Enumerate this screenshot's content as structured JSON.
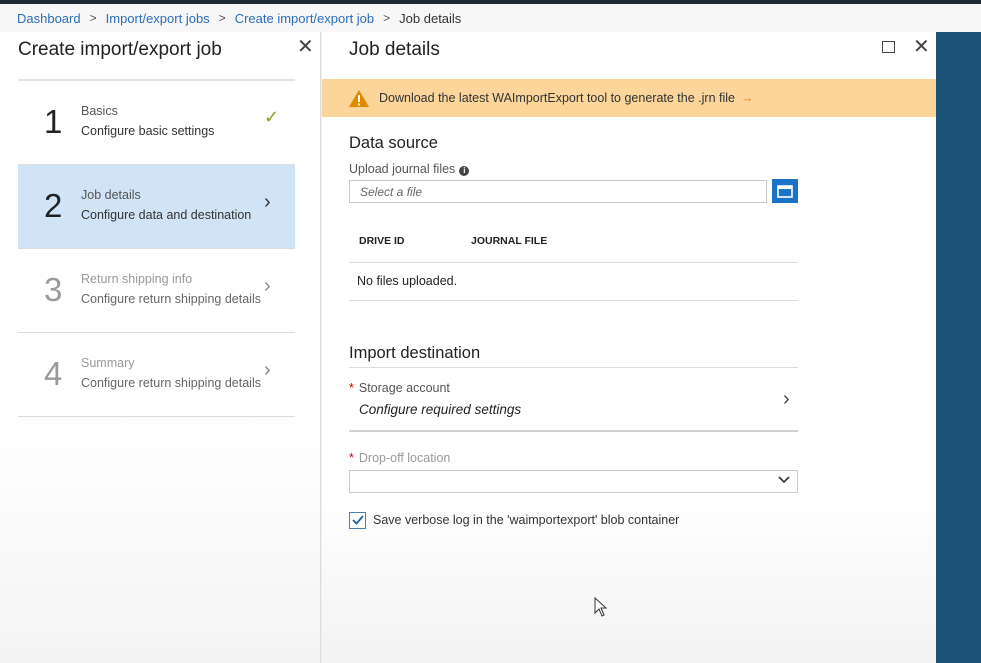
{
  "breadcrumb": {
    "items": [
      "Dashboard",
      "Import/export jobs",
      "Create import/export job"
    ],
    "current": "Job details",
    "separator": ">"
  },
  "left_blade": {
    "title": "Create import/export job",
    "close_glyph": "✕",
    "steps": [
      {
        "number": "1",
        "title": "Basics",
        "subtitle": "Configure basic settings",
        "state": "completed",
        "indicator": "✓"
      },
      {
        "number": "2",
        "title": "Job details",
        "subtitle": "Configure data and destination",
        "state": "active",
        "indicator": "›"
      },
      {
        "number": "3",
        "title": "Return shipping info",
        "subtitle": "Configure return shipping details",
        "state": "pending",
        "indicator": "›"
      },
      {
        "number": "4",
        "title": "Summary",
        "subtitle": "Configure return shipping details",
        "state": "pending",
        "indicator": "›"
      }
    ]
  },
  "right_blade": {
    "title": "Job details",
    "close_glyph": "✕",
    "warning": {
      "text": "Download the latest WAImportExport tool to generate the .jrn file",
      "arrow": "→"
    },
    "data_source": {
      "title": "Data source",
      "upload_label": "Upload journal files",
      "upload_info": "i",
      "upload_placeholder": "Select a file",
      "table_headers": [
        "DRIVE ID",
        "JOURNAL FILE"
      ],
      "empty_text": "No files uploaded."
    },
    "import_destination": {
      "title": "Import destination",
      "storage_label": "Storage account",
      "storage_value": "Configure required settings",
      "storage_chevron": "›",
      "required_mark": "*",
      "dropoff_label": "Drop-off location",
      "dropoff_value": "",
      "dropoff_caret": "⌄"
    },
    "verbose_log": {
      "label": "Save verbose log in the 'waimportexport' blob container",
      "checked": true
    }
  },
  "colors": {
    "link": "#2a6ebb",
    "active_step_bg": "#cfe4f7",
    "warning_bg": "#fbd59a",
    "accent_blue": "#1a73c6",
    "check_green": "#7ea61e",
    "edge_blue": "#1b5275"
  }
}
